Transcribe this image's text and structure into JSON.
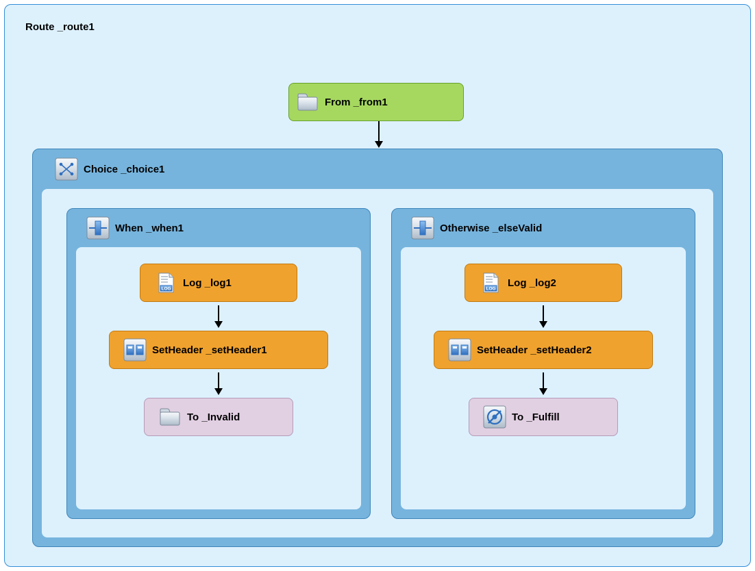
{
  "route": {
    "title": "Route _route1"
  },
  "from": {
    "label": "From _from1"
  },
  "choice": {
    "label": "Choice _choice1"
  },
  "when": {
    "label": "When _when1",
    "log": "Log _log1",
    "setheader": "SetHeader _setHeader1",
    "to": "To _Invalid"
  },
  "otherwise": {
    "label": "Otherwise _elseValid",
    "log": "Log _log2",
    "setheader": "SetHeader _setHeader2",
    "to": "To _Fulfill"
  },
  "colors": {
    "container_bg": "#DDF1FD",
    "container_border": "#348ED7",
    "from_bg": "#A6D860",
    "choice_bg": "#76B4DD",
    "step_orange": "#F0A22E",
    "step_purple": "#E1CFE2"
  }
}
